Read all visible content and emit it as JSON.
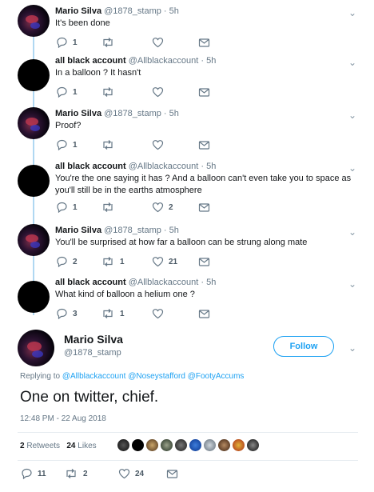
{
  "replies": [
    {
      "author": "Mario Silva",
      "handle": "@1878_stamp",
      "time": "5h",
      "text": "It's been done",
      "avatar": "mario",
      "counts": {
        "reply": "1",
        "retweet": "",
        "like": ""
      }
    },
    {
      "author": "all black account",
      "handle": "@Allblackaccount",
      "time": "5h",
      "text": "In a balloon ? It hasn't",
      "avatar": "black",
      "counts": {
        "reply": "1",
        "retweet": "",
        "like": ""
      }
    },
    {
      "author": "Mario Silva",
      "handle": "@1878_stamp",
      "time": "5h",
      "text": "Proof?",
      "avatar": "mario",
      "counts": {
        "reply": "1",
        "retweet": "",
        "like": ""
      }
    },
    {
      "author": "all black account",
      "handle": "@Allblackaccount",
      "time": "5h",
      "text": "You're the one saying it has ? And a balloon can't even take you to space as you'll still be in the earths atmosphere",
      "avatar": "black",
      "counts": {
        "reply": "1",
        "retweet": "",
        "like": "2"
      }
    },
    {
      "author": "Mario Silva",
      "handle": "@1878_stamp",
      "time": "5h",
      "text": "You'll be surprised at how far a balloon can be strung along mate",
      "avatar": "mario",
      "counts": {
        "reply": "2",
        "retweet": "1",
        "like": "21"
      }
    },
    {
      "author": "all black account",
      "handle": "@Allblackaccount",
      "time": "5h",
      "text": "What kind of balloon a helium one ?",
      "avatar": "black",
      "counts": {
        "reply": "3",
        "retweet": "1",
        "like": ""
      }
    }
  ],
  "main": {
    "author": "Mario Silva",
    "handle": "@1878_stamp",
    "follow_label": "Follow",
    "replying_prefix": "Replying to",
    "mentions": [
      "@Allblackaccount",
      "@Noseystafford",
      "@FootyAccums"
    ],
    "text": "One on twitter, chief.",
    "timestamp": "12:48 PM - 22 Aug 2018",
    "retweets": "2",
    "retweets_label": "Retweets",
    "likes": "24",
    "likes_label": "Likes",
    "counts": {
      "reply": "11",
      "retweet": "2",
      "like": "24"
    }
  },
  "colors": {
    "accent": "#1da1f2",
    "thread_line": "#b0d8f2",
    "muted": "#657786"
  },
  "icons": {
    "dot": "·",
    "chevron": "⌄"
  }
}
